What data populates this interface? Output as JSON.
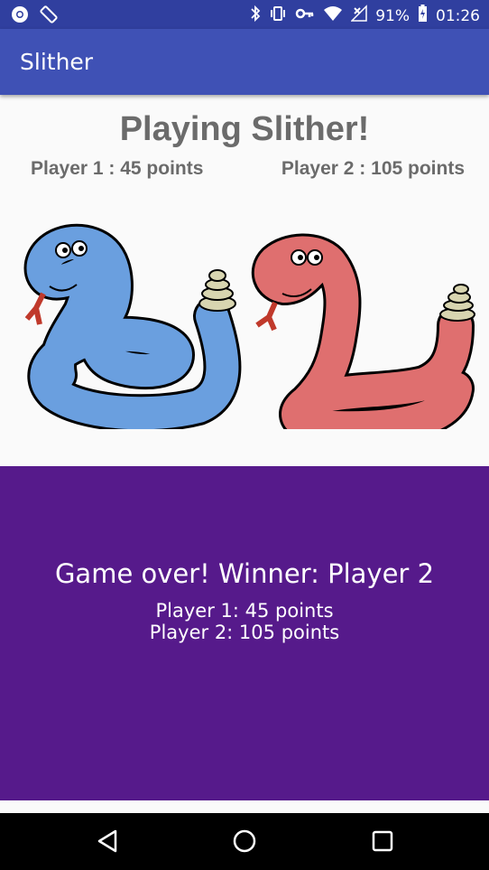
{
  "status_bar": {
    "battery": "91%",
    "time": "01:26",
    "icons": [
      "chrome-icon",
      "screen-rotation-icon",
      "bluetooth-icon",
      "vibrate-icon",
      "key-icon",
      "wifi-icon",
      "no-signal-icon",
      "battery-charging-icon"
    ]
  },
  "app_bar": {
    "title": "Slither"
  },
  "game": {
    "heading": "Playing Slither!",
    "player1_score": "Player 1 : 45 points",
    "player2_score": "Player 2 : 105 points",
    "snakes": [
      {
        "player": 1,
        "color": "#6a9fdf"
      },
      {
        "player": 2,
        "color": "#df6f6f"
      }
    ]
  },
  "game_over": {
    "winner_text": "Game over! Winner: Player 2",
    "player1_result": "Player 1: 45 points",
    "player2_result": "Player 2: 105 points",
    "background": "#561A8B"
  },
  "nav": {
    "buttons": [
      "back-icon",
      "home-icon",
      "recents-icon"
    ]
  },
  "colors": {
    "primary": "#3F51B5",
    "primary_dark": "#303F9F"
  }
}
